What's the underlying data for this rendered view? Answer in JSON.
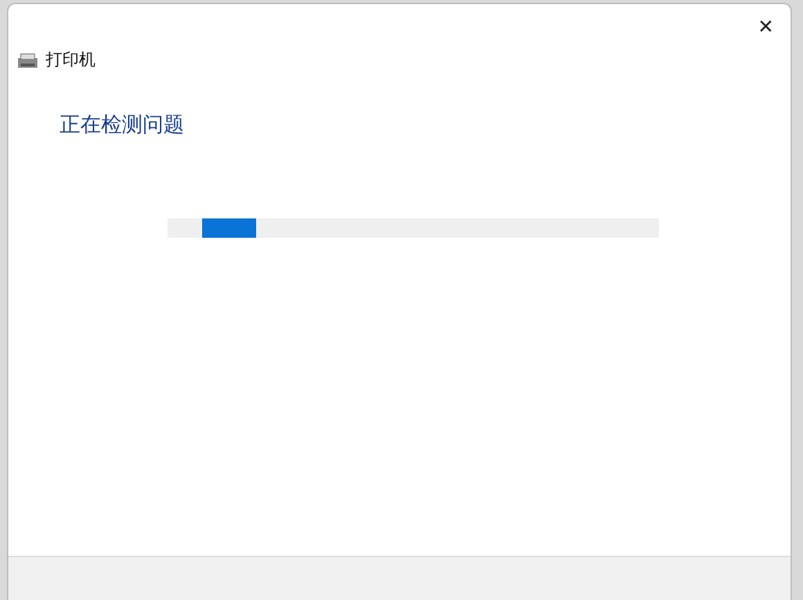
{
  "window": {
    "title": "打印机",
    "close": "✕"
  },
  "heading": "正在检测问题",
  "progress": {
    "kind": "indeterminate"
  }
}
